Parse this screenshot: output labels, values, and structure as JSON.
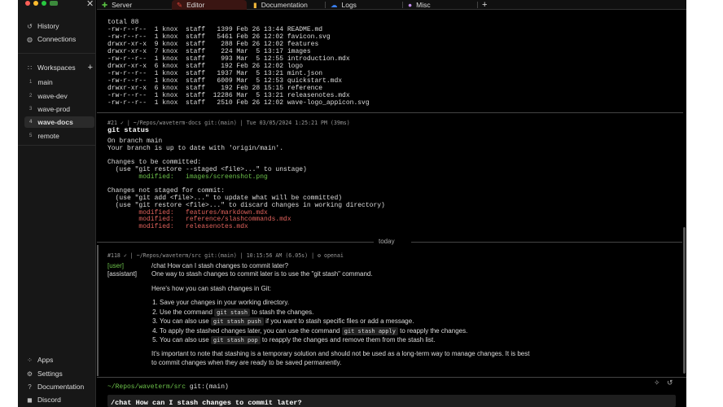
{
  "tabs": [
    {
      "label": "Server",
      "icon": "plus-icon",
      "color": "#58c142"
    },
    {
      "label": "Editor",
      "icon": "pencil-icon",
      "color": "#e0443a"
    },
    {
      "label": "Documentation",
      "icon": "file-icon",
      "color": "#f0b73a"
    },
    {
      "label": "Logs",
      "icon": "cloud-icon",
      "color": "#3a7ff0"
    },
    {
      "label": "Misc",
      "icon": "ghost-icon",
      "color": "#c68ff0"
    }
  ],
  "sidebar": {
    "history": "History",
    "connections": "Connections",
    "workspaces_label": "Workspaces",
    "workspaces": [
      {
        "num": "1",
        "label": "main"
      },
      {
        "num": "2",
        "label": "wave-dev"
      },
      {
        "num": "3",
        "label": "wave-prod"
      },
      {
        "num": "4",
        "label": "wave-docs"
      },
      {
        "num": "5",
        "label": "remote"
      }
    ],
    "apps": "Apps",
    "settings": "Settings",
    "documentation": "Documentation",
    "discord": "Discord"
  },
  "block1": {
    "lines": [
      "total 88",
      "-rw-r--r--  1 knox  staff   1399 Feb 26 13:44 README.md",
      "-rw-r--r--  1 knox  staff   5461 Feb 26 12:02 favicon.svg",
      "drwxr-xr-x  9 knox  staff    288 Feb 26 12:02 features",
      "drwxr-xr-x  7 knox  staff    224 Mar  5 13:17 images",
      "-rw-r--r--  1 knox  staff    993 Mar  5 12:55 introduction.mdx",
      "drwxr-xr-x  6 knox  staff    192 Feb 26 12:02 logo",
      "-rw-r--r--  1 knox  staff   1937 Mar  5 13:21 mint.json",
      "-rw-r--r--  1 knox  staff   6009 Mar  5 12:53 quickstart.mdx",
      "drwxr-xr-x  6 knox  staff    192 Feb 28 15:15 reference",
      "-rw-r--r--  1 knox  staff  12286 Mar  5 13:21 releasenotes.mdx",
      "-rw-r--r--  1 knox  staff   2510 Feb 26 12:02 wave-logo_appicon.svg"
    ]
  },
  "block2": {
    "meta": "#21 ✓ | ~/Repos/waveterm-docs git:(main) | Tue 03/05/2024 1:25:21 PM (39ms)",
    "command": "git status",
    "l1": "On branch main",
    "l2": "Your branch is up to date with 'origin/main'.",
    "l3": "Changes to be committed:",
    "l4": "  (use \"git restore --staged <file>...\" to unstage)",
    "staged": "        modified:   images/screenshot.png",
    "l5": "Changes not staged for commit:",
    "l6": "  (use \"git add <file>...\" to update what will be committed)",
    "l7": "  (use \"git restore <file>...\" to discard changes in working directory)",
    "unstaged": [
      "        modified:   features/markdown.mdx",
      "        modified:   reference/slashcommands.mdx",
      "        modified:   releasenotes.mdx"
    ]
  },
  "divider": "today",
  "block3": {
    "meta": "#118 ✓ | ~/Repos/waveterm/src git:(main) | 10:15:56 AM (6.05s) | ⚙ openai",
    "user_role": "[user]",
    "assistant_role": "[assistant]",
    "user_msg": "/chat How can I stash changes to commit later?",
    "a1": "One way to stash changes to commit later is to use the \"git stash\" command.",
    "a2": "Here's how you can stash changes in Git:",
    "steps": [
      {
        "pre": "Save your changes in your working directory.",
        "code": "",
        "post": ""
      },
      {
        "pre": "Use the command ",
        "code": "git stash",
        "post": " to stash the changes."
      },
      {
        "pre": "You can also use ",
        "code": "git stash push",
        "post": " if you want to stash specific files or add a message."
      },
      {
        "pre": "To apply the stashed changes later, you can use the command ",
        "code": "git stash apply",
        "post": " to reapply the changes."
      },
      {
        "pre": "You can also use ",
        "code": "git stash pop",
        "post": " to reapply the changes and remove them from the stash list."
      }
    ],
    "a3": "It's important to note that stashing is a temporary solution and should not be used as a long-term way to manage changes. It is best to commit changes when they are ready to be saved permanently."
  },
  "prompt": {
    "path": "~/Repos/waveterm/src",
    "branch": "git:(main)",
    "input": "/chat How can I stash changes to commit later?"
  }
}
